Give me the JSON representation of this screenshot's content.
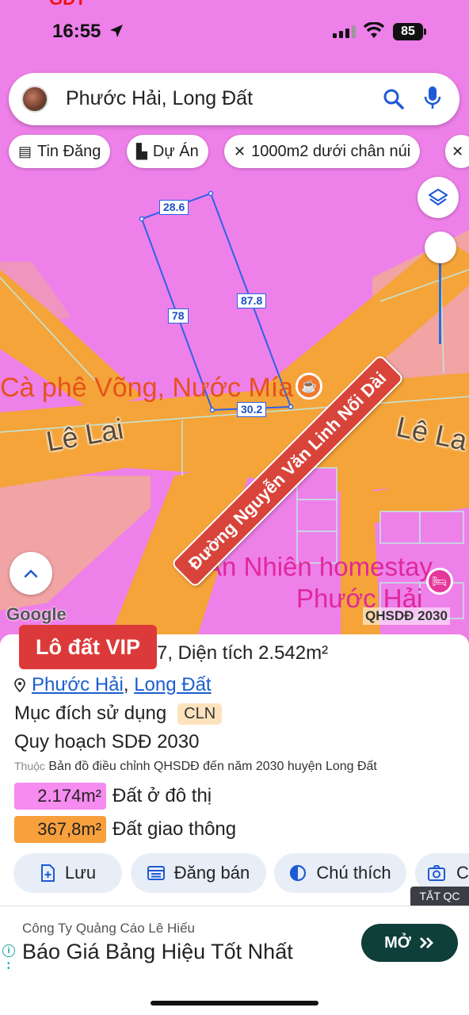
{
  "status_bar": {
    "time": "16:55",
    "battery": "85",
    "top_partial_text": "GDT"
  },
  "search": {
    "query": "Phước Hải, Long Đất"
  },
  "chips": [
    {
      "label": "Tin Đăng",
      "icon": "listing-icon"
    },
    {
      "label": "Dự Án",
      "icon": "building-icon"
    },
    {
      "label": "1000m2 dưới chân núi",
      "icon": "measure-icon"
    }
  ],
  "map": {
    "labels": {
      "cafe": "Cà phê Võng, Nước Mía",
      "street_1": "Lê Lai",
      "street_2": "Lê La",
      "homestay_1": "An Nhiên homestay",
      "homestay_2": "Phước Hải",
      "road_sign": "Đường Nguyễn Văn Linh Nối Dài",
      "google": "Google",
      "qhsdd": "QHSDĐ 2030"
    },
    "dimensions": [
      "28.6",
      "87.8",
      "78",
      "30.2"
    ]
  },
  "panel": {
    "vip_badge": "Lô đất VIP",
    "title_partial": "7, Diện tích ",
    "area": "2.542m²",
    "address_ward": "Phước Hải",
    "address_sep": ",",
    "address_district": "Long Đất",
    "purpose_label": "Mục đích sử dụng",
    "purpose_code": "CLN",
    "plan_label": "Quy hoạch SDĐ 2030",
    "source_prefix": "Thuộc",
    "source_text": "Bản đồ điều chỉnh QHSDĐ đến năm 2030 huyện Long Đất",
    "land_uses": [
      {
        "area": "2.174m²",
        "label": "Đất ở đô thị",
        "color": "#f68bf0"
      },
      {
        "area": "367,8m²",
        "label": "Đất giao thông",
        "color": "#f7a03c"
      }
    ],
    "actions": [
      {
        "label": "Lưu",
        "icon": "save-icon"
      },
      {
        "label": "Đăng bán",
        "icon": "post-icon"
      },
      {
        "label": "Chú thích",
        "icon": "legend-icon"
      },
      {
        "label": "C",
        "icon": "camera-icon"
      }
    ],
    "tat_qc": "TẮT QC"
  },
  "ad": {
    "company": "Công Ty Quảng Cáo Lê Hiếu",
    "headline": "Báo Giá Bảng Hiệu Tốt Nhất",
    "button": "MỞ"
  },
  "colors": {
    "residential": "#ee80ea",
    "road": "#f5a43a",
    "accent_blue": "#1f5ad6",
    "vip_red": "#dc3a3a",
    "ad_button": "#0e3f3a"
  }
}
